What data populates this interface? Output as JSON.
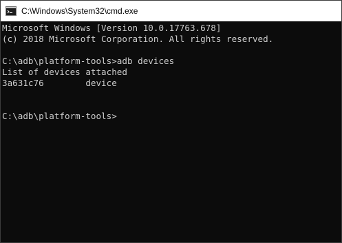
{
  "window": {
    "title": "C:\\Windows\\System32\\cmd.exe",
    "icon": "console-icon",
    "colors": {
      "titlebar_bg": "#ffffff",
      "console_bg": "#0c0c0c",
      "console_text": "#cccccc"
    }
  },
  "console": {
    "lines": [
      "Microsoft Windows [Version 10.0.17763.678]",
      "(c) 2018 Microsoft Corporation. All rights reserved.",
      "",
      "C:\\adb\\platform-tools>adb devices",
      "List of devices attached",
      "3a631c76        device",
      "",
      "",
      "C:\\adb\\platform-tools>"
    ]
  }
}
